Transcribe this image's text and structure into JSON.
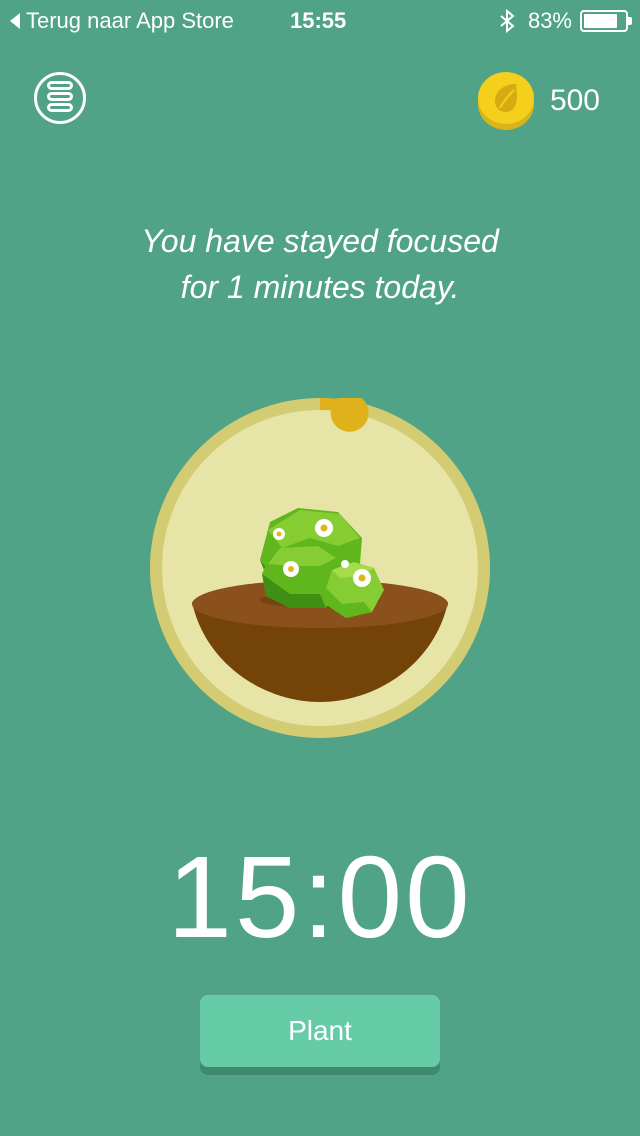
{
  "status_bar": {
    "back_label": "Terug naar App Store",
    "time": "15:55",
    "battery_percent": "83%",
    "battery_level": 0.83,
    "icons": [
      "back-arrow-icon",
      "bluetooth-icon",
      "battery-icon"
    ]
  },
  "header": {
    "menu_icon": "menu-icon",
    "coin_icon": "coin-icon",
    "coins": "500"
  },
  "message": {
    "line1": "You have stayed focused",
    "line2": "for 1 minutes today."
  },
  "tree": {
    "icon": "bush-tree-icon",
    "progress": 0.03
  },
  "timer": "15:00",
  "plant_button_label": "Plant",
  "colors": {
    "background": "#51a387",
    "ring_outer": "#d3cc73",
    "ring_inner": "#e6e5a7",
    "progress_knob": "#dfb21c",
    "bowl": "#744308",
    "soil": "#8b511c",
    "leaf_dark": "#3f8f14",
    "leaf": "#5fb61d",
    "leaf_light": "#86cd33",
    "button": "#66cba7",
    "coin": "#f4cf1c"
  }
}
